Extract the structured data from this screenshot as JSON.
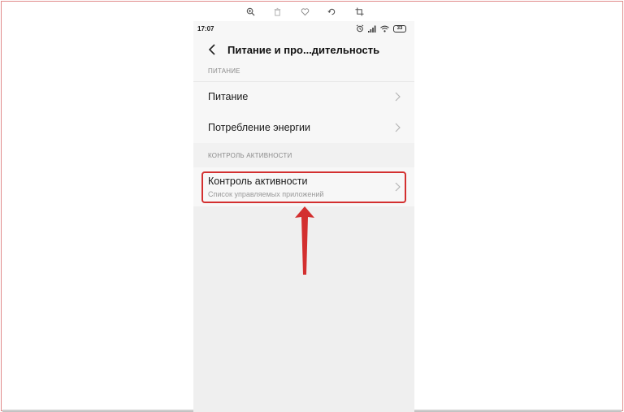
{
  "viewer_toolbar": {
    "tools": [
      "zoom-in-icon",
      "trash-icon",
      "heart-icon",
      "rotate-icon",
      "crop-icon"
    ]
  },
  "status_bar": {
    "time": "17:07",
    "battery_level": "33",
    "icons": [
      "alarm-icon",
      "signal-icon",
      "wifi-icon",
      "battery-icon"
    ]
  },
  "header": {
    "title": "Питание и про...дительность",
    "back_icon": "chevron-left-icon"
  },
  "sections": [
    {
      "header": "ПИТАНИЕ",
      "items": [
        {
          "label": "Питание"
        },
        {
          "label": "Потребление энергии"
        }
      ]
    },
    {
      "header": "КОНТРОЛЬ АКТИВНОСТИ",
      "items": [
        {
          "label": "Контроль активности",
          "sublabel": "Список управляемых приложений"
        }
      ]
    }
  ],
  "colors": {
    "highlight": "#d32f2f",
    "screen_background": "#f1f1f1",
    "section_header_text": "#8a8a8a"
  }
}
